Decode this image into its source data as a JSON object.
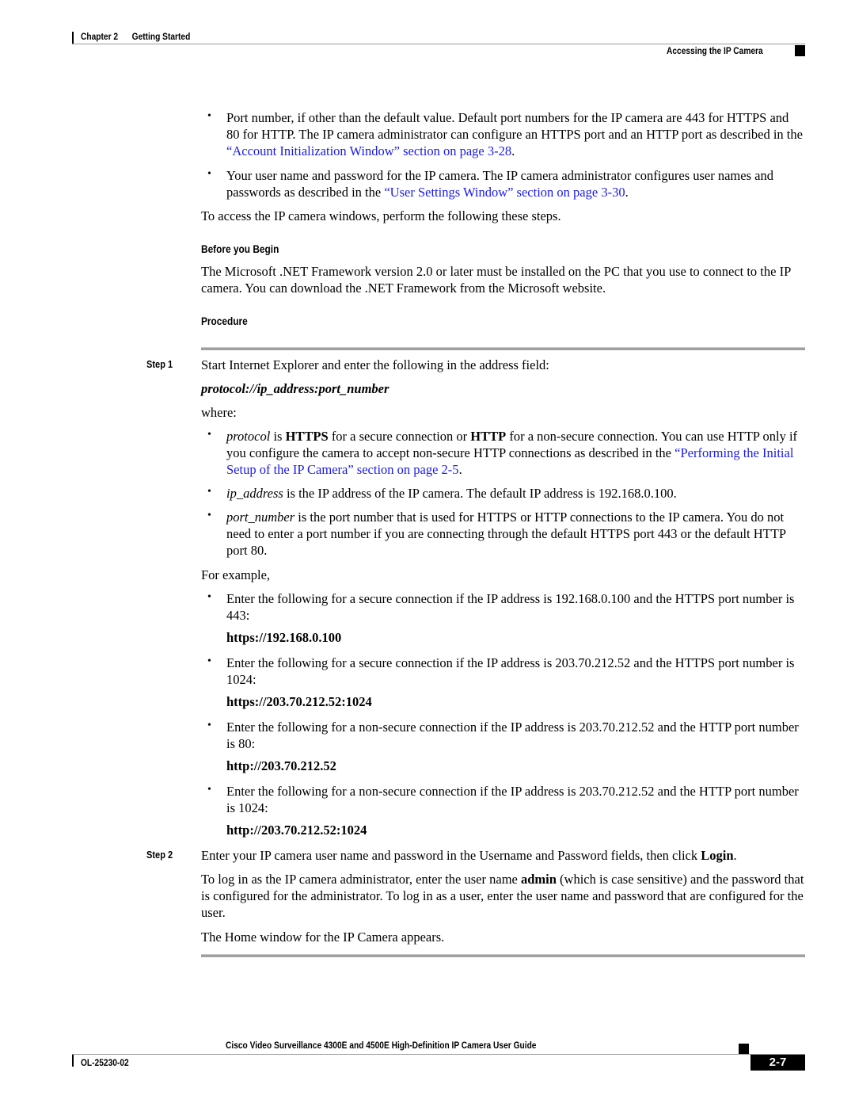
{
  "header": {
    "chapter": "Chapter 2",
    "chapter_title": "Getting Started",
    "section": "Accessing the IP Camera"
  },
  "intro_bullets": [
    {
      "text_before": "Port number, if other than the default value. Default port numbers for the IP camera are 443 for HTTPS and 80 for HTTP. The IP camera administrator can configure an HTTPS port and an HTTP port as described in the ",
      "link": "“Account Initialization Window” section on page 3-28",
      "text_after": "."
    },
    {
      "text_before": "Your user name and password for the IP camera. The IP camera administrator configures user names and passwords as described in the ",
      "link": "“User Settings Window” section on page 3-30",
      "text_after": "."
    }
  ],
  "intro_paragraph": "To access the IP camera windows, perform the following these steps.",
  "before_you_begin": {
    "heading": "Before you Begin",
    "text": "The Microsoft .NET Framework version 2.0 or later must be installed on the PC that you use to connect to the IP camera. You can download the .NET Framework from the Microsoft website."
  },
  "procedure": {
    "heading": "Procedure",
    "steps": [
      {
        "label": "Step 1",
        "text": "Start Internet Explorer and enter the following in the address field:",
        "syntax": "protocol://ip_address:port_number",
        "where": "where:",
        "definitions": [
          {
            "term": "protocol",
            "p1": " is ",
            "b1": "HTTPS",
            "p2": " for a secure connection or ",
            "b2": "HTTP",
            "p3": " for a non-secure connection. You can use HTTP only if you configure the camera to accept non-secure HTTP connections as described in the ",
            "link": "“Performing the Initial Setup of the IP Camera” section on page 2-5",
            "p4": "."
          },
          {
            "term": "ip_address",
            "text": " is the IP address of the IP camera. The default IP address is 192.168.0.100."
          },
          {
            "term": "port_number",
            "text": " is the port number that is used for HTTPS or HTTP connections to the IP camera. You do not need to enter a port number if you are connecting through the default HTTPS port 443 or the default HTTP port 80."
          }
        ],
        "example_intro": "For example,",
        "examples": [
          {
            "text": "Enter the following for a secure connection if the IP address is 192.168.0.100 and the HTTPS port number is 443:",
            "url": "https://192.168.0.100"
          },
          {
            "text": "Enter the following for a secure connection if the IP address is 203.70.212.52 and the HTTPS port number is 1024:",
            "url": "https://203.70.212.52:1024"
          },
          {
            "text": "Enter the following for a non-secure connection if the IP address is 203.70.212.52 and the HTTP port number is 80:",
            "url": "http://203.70.212.52"
          },
          {
            "text": "Enter the following for a non-secure connection if the IP address is 203.70.212.52 and the HTTP port number is 1024:",
            "url": "http://203.70.212.52:1024"
          }
        ]
      },
      {
        "label": "Step 2",
        "text_before": "Enter your IP camera user name and password in the Username and Password fields, then click ",
        "bold": "Login",
        "text_after": ".",
        "note_before": "To log in as the IP camera administrator, enter the user name ",
        "note_bold": "admin",
        "note_after": " (which is case sensitive) and the password that is configured for the administrator. To log in as a user, enter the user name and password that are configured for the user.",
        "result": "The Home window for the IP Camera appears."
      }
    ]
  },
  "footer": {
    "guide_title": "Cisco Video Surveillance 4300E and 4500E High-Definition IP Camera User Guide",
    "doc_number": "OL-25230-02",
    "page_number": "2-7"
  }
}
